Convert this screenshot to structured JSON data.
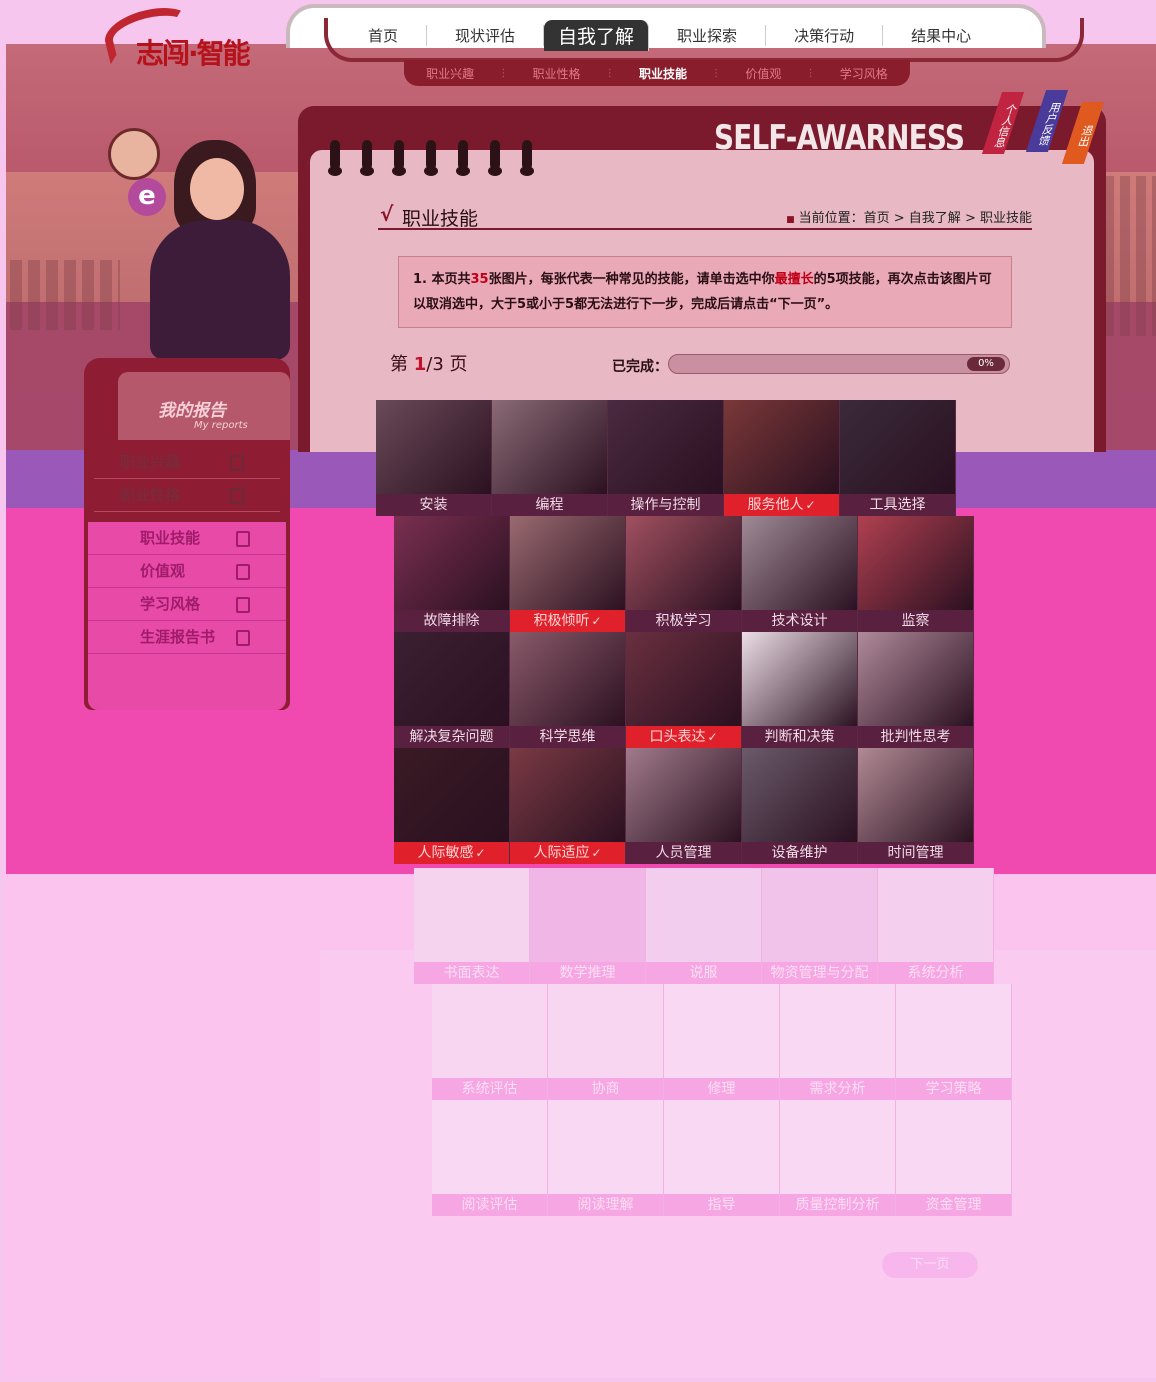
{
  "logo": {
    "text": "志闯·智能"
  },
  "nav": {
    "items": [
      "首页",
      "现状评估",
      "自我了解",
      "职业探索",
      "决策行动",
      "结果中心"
    ],
    "active": "自我了解"
  },
  "subnav": {
    "items": [
      "职业兴趣",
      "职业性格",
      "职业技能",
      "价值观",
      "学习风格"
    ],
    "active": "职业技能"
  },
  "banner": {
    "title": "SELF-AWARNESS"
  },
  "ribbons": [
    "个人信息",
    "用户反馈",
    "退出"
  ],
  "section": {
    "title": "职业技能",
    "breadcrumb_prefix": "当前位置：",
    "breadcrumb": [
      "首页",
      "自我了解",
      "职业技能"
    ]
  },
  "instructions": {
    "part1": "1. 本页共",
    "count": "35",
    "part2": "张图片，每张代表一种常见的技能，请单击选中你",
    "highlight": "最擅长",
    "part3": "的5项技能，再次点击该图片可以取消选中，大于5或小于5都无法进行下一步，完成后请点击“下一页”。"
  },
  "pager": {
    "prefix": "第",
    "current": "1",
    "total": "/3",
    "suffix": "页"
  },
  "progress": {
    "label": "已完成：",
    "value_text": "0%",
    "value": 0
  },
  "report": {
    "title": "我的报告",
    "subtitle": "My reports",
    "items": [
      "职业兴趣",
      "职业性格",
      "职业技能",
      "价值观",
      "学习风格",
      "生涯报告书"
    ]
  },
  "skills": [
    {
      "label": "安装",
      "selected": false,
      "color": "#6a4a58"
    },
    {
      "label": "编程",
      "selected": false,
      "color": "#8a6a76"
    },
    {
      "label": "操作与控制",
      "selected": false,
      "color": "#4a2a40"
    },
    {
      "label": "服务他人",
      "selected": true,
      "color": "#7a3838"
    },
    {
      "label": "工具选择",
      "selected": false,
      "color": "#3a2a3a"
    },
    {
      "label": "故障排除",
      "selected": false,
      "color": "#7a3050"
    },
    {
      "label": "积极倾听",
      "selected": true,
      "color": "#9a6a70"
    },
    {
      "label": "积极学习",
      "selected": false,
      "color": "#a05060"
    },
    {
      "label": "技术设计",
      "selected": false,
      "color": "#a08a96"
    },
    {
      "label": "监察",
      "selected": false,
      "color": "#b04050"
    },
    {
      "label": "解决复杂问题",
      "selected": false,
      "color": "#3a2030"
    },
    {
      "label": "科学思维",
      "selected": false,
      "color": "#8a5a6a"
    },
    {
      "label": "口头表达",
      "selected": true,
      "color": "#6a3040"
    },
    {
      "label": "判断和决策",
      "selected": false,
      "color": "#ecdde6"
    },
    {
      "label": "批判性思考",
      "selected": false,
      "color": "#b08a9a"
    },
    {
      "label": "人际敏感",
      "selected": true,
      "color": "#3a1a24"
    },
    {
      "label": "人际适应",
      "selected": true,
      "color": "#7a3a44"
    },
    {
      "label": "人员管理",
      "selected": false,
      "color": "#a07a8a"
    },
    {
      "label": "设备维护",
      "selected": false,
      "color": "#6a5a6a"
    },
    {
      "label": "时间管理",
      "selected": false,
      "color": "#b08a94"
    },
    {
      "label": "书面表达",
      "selected": false,
      "color": "#f5d2ee"
    },
    {
      "label": "数学推理",
      "selected": false,
      "color": "#f0b6e6"
    },
    {
      "label": "说服",
      "selected": false,
      "color": "#f3cdee"
    },
    {
      "label": "物资管理与分配",
      "selected": false,
      "color": "#f1c2ea"
    },
    {
      "label": "系统分析",
      "selected": false,
      "color": "#f4cfee"
    },
    {
      "label": "系统评估",
      "selected": false,
      "color": "#f8d6f2"
    },
    {
      "label": "协商",
      "selected": false,
      "color": "#f8d6f2"
    },
    {
      "label": "修理",
      "selected": false,
      "color": "#f8d8f2"
    },
    {
      "label": "需求分析",
      "selected": false,
      "color": "#f8d8f2"
    },
    {
      "label": "学习策略",
      "selected": false,
      "color": "#f8d8f2"
    },
    {
      "label": "阅读评估",
      "selected": false,
      "color": "#f8d8f2"
    },
    {
      "label": "阅读理解",
      "selected": false,
      "color": "#f8d8f2"
    },
    {
      "label": "指导",
      "selected": false,
      "color": "#f8d8f2"
    },
    {
      "label": "质量控制分析",
      "selected": false,
      "color": "#f8d8f2"
    },
    {
      "label": "资金管理",
      "selected": false,
      "color": "#f8d8f2"
    }
  ],
  "next_button": "下一页"
}
